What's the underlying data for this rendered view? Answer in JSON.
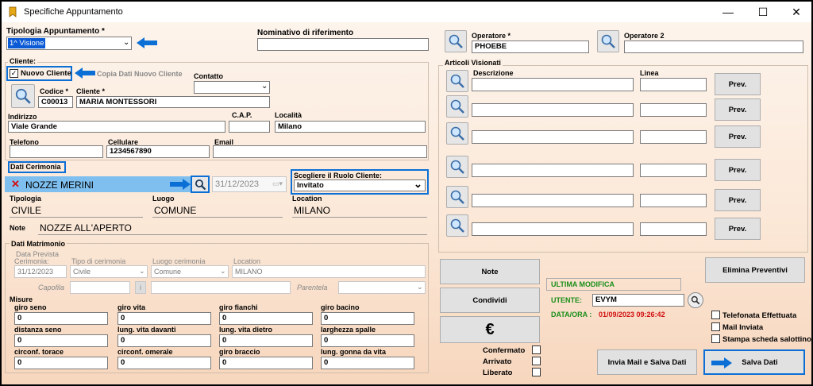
{
  "window": {
    "title": "Specifiche Appuntamento",
    "minimize": "—",
    "maximize": "☐",
    "close": "✕"
  },
  "appointment": {
    "type_label": "Tipologia Appuntamento *",
    "type_value": "1^ Visione",
    "referent_label": "Nominativo di riferimento",
    "referent_value": ""
  },
  "operators": {
    "op1_label": "Operatore *",
    "op1_value": "PHOEBE",
    "op2_label": "Operatore 2",
    "op2_value": ""
  },
  "client": {
    "section_label": "Cliente:",
    "new_client_label": "Nuovo Cliente",
    "copy_label": "Copia Dati Nuovo Cliente",
    "contact_label": "Contatto",
    "code_label": "Codice *",
    "code_value": "C00013",
    "client_label": "Cliente *",
    "client_value": "MARIA  MONTESSORI",
    "address_label": "Indirizzo",
    "address_value": "Viale Grande",
    "cap_label": "C.A.P.",
    "cap_value": "",
    "city_label": "Località",
    "city_value": "Milano",
    "phone_label": "Telefono",
    "phone_value": "",
    "mobile_label": "Cellulare",
    "mobile_value": "1234567890",
    "email_label": "Email",
    "email_value": ""
  },
  "ceremony": {
    "section_label": "Dati Cerimonia",
    "name_value": "NOZZE MERINI",
    "date_value": "31/12/2023",
    "role_label": "Scegliere il Ruolo Cliente:",
    "role_value": "Invitato",
    "tipologia_label": "Tipologia",
    "tipologia_value": "CIVILE",
    "luogo_label": "Luogo",
    "luogo_value": "COMUNE",
    "location_label": "Location",
    "location_value": "MILANO",
    "note_label": "Note",
    "note_value": "NOZZE ALL'APERTO"
  },
  "wedding": {
    "section_label": "Dati Matrimonio",
    "date_label1": "Data Prevista",
    "date_label2": "Cerimonia:",
    "date_value": "31/12/2023",
    "type_label": "Tipo di cerimonia",
    "type_value": "Civile",
    "place_label": "Luogo cerimonia",
    "place_value": "Comune",
    "location_label": "Location",
    "location_value": "MILANO",
    "capofila_label": "Capofila",
    "parentela_label": "Parentela"
  },
  "measures": {
    "section_label": "Misure",
    "items": [
      {
        "label": "giro seno",
        "value": "0"
      },
      {
        "label": "giro vita",
        "value": "0"
      },
      {
        "label": "giro fianchi",
        "value": "0"
      },
      {
        "label": "giro bacino",
        "value": "0"
      },
      {
        "label": "distanza seno",
        "value": "0"
      },
      {
        "label": "lung. vita davanti",
        "value": "0"
      },
      {
        "label": "lung. vita dietro",
        "value": "0"
      },
      {
        "label": "larghezza spalle",
        "value": "0"
      },
      {
        "label": "circonf. torace",
        "value": "0"
      },
      {
        "label": "circonf. omerale",
        "value": "0"
      },
      {
        "label": "giro braccio",
        "value": "0"
      },
      {
        "label": "lung. gonna da vita",
        "value": "0"
      }
    ]
  },
  "articles": {
    "section_label": "Articoli Visionati",
    "desc_label": "Descrizione",
    "line_label": "Linea",
    "prev_label": "Prev.",
    "rows": [
      {
        "desc": "",
        "line": ""
      },
      {
        "desc": "",
        "line": ""
      },
      {
        "desc": "",
        "line": ""
      },
      {
        "desc": "",
        "line": ""
      },
      {
        "desc": "",
        "line": ""
      },
      {
        "desc": "",
        "line": ""
      }
    ]
  },
  "actions": {
    "note": "Note",
    "share": "Condividi",
    "euro": "€",
    "delete_quotes": "Elimina Preventivi",
    "send_mail_save": "Invia Mail e Salva Dati",
    "save": "Salva Dati"
  },
  "last_modified": {
    "title": "ULTIMA MODIFICA",
    "user_label": "UTENTE:",
    "user_value": "EVYM",
    "datetime_label": "DATA/ORA :",
    "datetime_value": "01/09/2023 09:26:42"
  },
  "flags": {
    "phone_done": "Telefonata Effettuata",
    "mail_sent": "Mail Inviata",
    "print_sheet": "Stampa scheda salottino",
    "confirmed": "Confermato",
    "arrived": "Arrivato",
    "freed": "Liberato"
  },
  "colors": {
    "highlight": "#0b6fd6",
    "green": "#1a8f1a",
    "red": "#d01010"
  }
}
